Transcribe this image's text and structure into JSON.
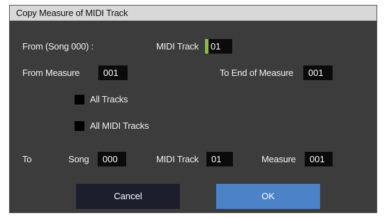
{
  "dialog": {
    "title": "Copy Measure of MIDI Track"
  },
  "from": {
    "song_label": "From (Song 000) :",
    "midi_track_label": "MIDI Track",
    "midi_track_value": "01",
    "from_measure_label": "From Measure",
    "from_measure_value": "001",
    "to_end_label": "To End of Measure",
    "to_end_value": "001"
  },
  "options": {
    "all_tracks_label": "All Tracks",
    "all_tracks_checked": false,
    "all_midi_tracks_label": "All MIDI Tracks",
    "all_midi_tracks_checked": false
  },
  "to": {
    "to_label": "To",
    "song_label": "Song",
    "song_value": "000",
    "midi_track_label": "MIDI Track",
    "midi_track_value": "01",
    "measure_label": "Measure",
    "measure_value": "001"
  },
  "buttons": {
    "cancel_label": "Cancel",
    "ok_label": "OK"
  },
  "colors": {
    "dialog_bg": "#3c3c3c",
    "titlebar_bg": "#d8d8d8",
    "field_bg": "#0b0b0b",
    "focus_accent": "#8fbf3a",
    "cancel_bg": "#1c1e2c",
    "ok_bg": "#4c82c8"
  }
}
